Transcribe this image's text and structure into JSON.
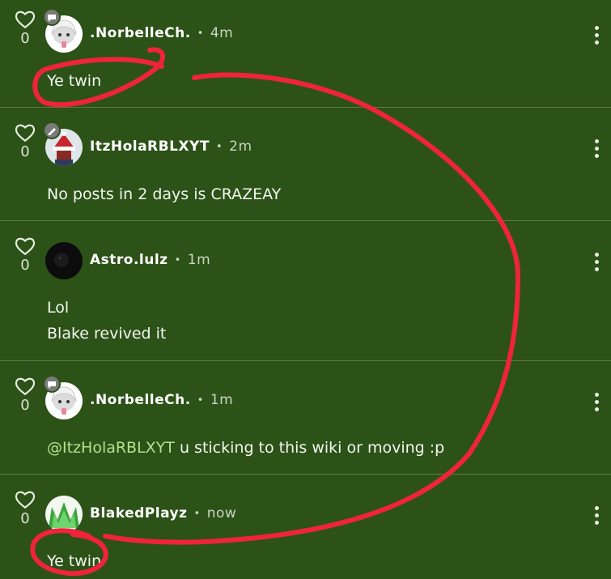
{
  "colors": {
    "background": "#2c5217",
    "mention": "#b7e08f",
    "scribble": "#f0233c"
  },
  "comments": [
    {
      "username": ".NorbelleCh.",
      "time": "4m",
      "likes": "0",
      "lines": [
        "Ye twin"
      ],
      "avatar": "white-hair-avatar-icon",
      "badge": "chat-bubble-icon"
    },
    {
      "username": "ItzHolaRBLXYT",
      "time": "2m",
      "likes": "0",
      "lines": [
        "No posts in 2 days is CRAZEAY"
      ],
      "avatar": "santa-hat-avatar-icon",
      "badge": "pencil-icon"
    },
    {
      "username": "Astro.lulz",
      "time": "1m",
      "likes": "0",
      "lines": [
        "Lol",
        "Blake revived it"
      ],
      "avatar": "dark-avatar-icon"
    },
    {
      "username": ".NorbelleCh.",
      "time": "1m",
      "likes": "0",
      "mention": "@ItzHolaRBLXYT",
      "lines": [
        " u sticking to this wiki or moving :p"
      ],
      "avatar": "white-hair-avatar-icon",
      "badge": "chat-bubble-icon"
    },
    {
      "username": "BlakedPlayz",
      "time": "now",
      "likes": "0",
      "lines": [
        "Ye twin"
      ],
      "avatar": "green-crown-avatar-icon"
    }
  ]
}
